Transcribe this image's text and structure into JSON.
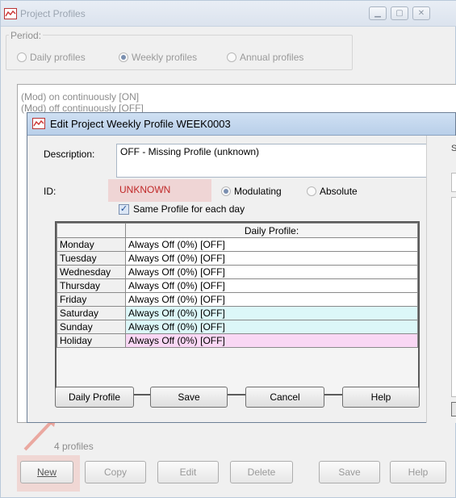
{
  "main_window": {
    "title": "Project Profiles",
    "period": {
      "legend": "Period:",
      "options": [
        {
          "label": "Daily profiles",
          "selected": false
        },
        {
          "label": "Weekly profiles",
          "selected": true
        },
        {
          "label": "Annual profiles",
          "selected": false
        }
      ]
    },
    "list_items": [
      "(Mod) on continuously [ON]",
      "(Mod) off continuously [OFF]"
    ],
    "count_label": "4 profiles",
    "buttons": {
      "new": "New",
      "copy": "Copy",
      "edit": "Edit",
      "delete": "Delete",
      "save": "Save",
      "help": "Help"
    }
  },
  "dialog": {
    "title": "Edit Project Weekly Profile WEEK0003",
    "description_label": "Description:",
    "description_value": "OFF - Missing Profile (unknown)",
    "id_label": "ID:",
    "id_value": "UNKNOWN",
    "mode": {
      "modulating": "Modulating",
      "absolute": "Absolute",
      "selected": "modulating"
    },
    "same_profile_label": "Same Profile for each day",
    "same_profile_checked": true,
    "grid_header": "Daily Profile:",
    "days": [
      {
        "day": "Monday",
        "profile": "Always Off (0%) [OFF]",
        "style": "white"
      },
      {
        "day": "Tuesday",
        "profile": "Always Off (0%) [OFF]",
        "style": "white"
      },
      {
        "day": "Wednesday",
        "profile": "Always Off (0%) [OFF]",
        "style": "white"
      },
      {
        "day": "Thursday",
        "profile": "Always Off (0%) [OFF]",
        "style": "white"
      },
      {
        "day": "Friday",
        "profile": "Always Off (0%) [OFF]",
        "style": "white"
      },
      {
        "day": "Saturday",
        "profile": "Always Off (0%) [OFF]",
        "style": "cyan"
      },
      {
        "day": "Sunday",
        "profile": "Always Off (0%) [OFF]",
        "style": "cyan"
      },
      {
        "day": "Holiday",
        "profile": "Always Off (0%) [OFF]",
        "style": "pink"
      }
    ],
    "buttons": {
      "daily_profile": "Daily Profile",
      "save": "Save",
      "cancel": "Cancel",
      "help": "Help"
    }
  },
  "colors": {
    "weekend_row": "#dcf7f8",
    "holiday_row": "#f9d7f4",
    "highlight": "#eeb4b4"
  }
}
